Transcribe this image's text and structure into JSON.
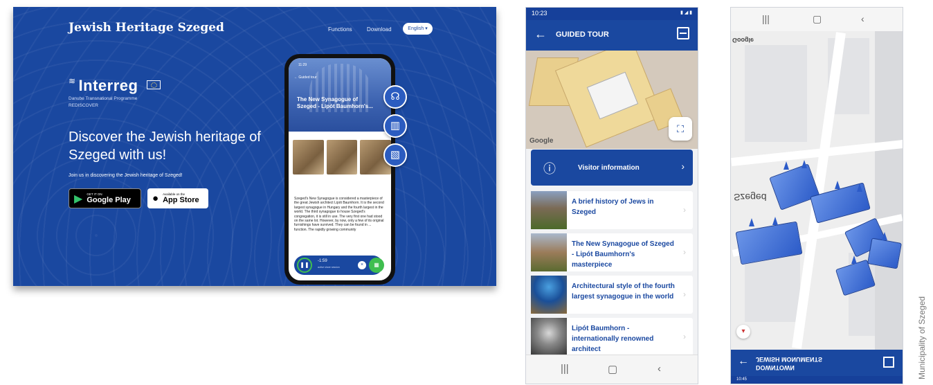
{
  "website": {
    "title": "Jewish Heritage Szeged",
    "nav": [
      "Functions",
      "Download"
    ],
    "language": "English",
    "interreg": {
      "name": "Interreg",
      "sub1": "Danube Transnational Programme",
      "sub2": "REDISCOVER"
    },
    "headline": "Discover the Jewish heritage of Szeged with us!",
    "join_text": "Join us in discovering the Jewish heritage of Szeged!",
    "google_play": {
      "small": "GET IT ON",
      "big": "Google Play"
    },
    "app_store": {
      "small": "Available on the",
      "big": "App Store"
    },
    "phone": {
      "time": "11:29",
      "back_label": "Guided tour",
      "title": "The New Synagogue of Szeged - Lipót Baumhorn's...",
      "body": "Szeged's New Synagogue is considered a masterpiece of the great Jewish architect Lipót Baumhorn. It is the second largest synagogue in Hungary and the fourth largest in the world. The third synagogue to house Szeged's congregation, it is still in use. The very first one had stood on the same lot. However, by now, only a few of its original furnishings have survived. They can be found in ... function. The rapidly growing community",
      "player_time": "-1:59",
      "player_sub": "active share session"
    }
  },
  "app1": {
    "time": "10:23",
    "title": "GUIDED TOUR",
    "map_logo": "Google",
    "visitor_info": "Visitor information",
    "items": [
      {
        "label": "A brief history of Jews in Szeged"
      },
      {
        "label": "The New Synagogue of Szeged - Lipót Baumhorn's masterpiece"
      },
      {
        "label": "Architectural style of the fourth largest synagogue in the world"
      },
      {
        "label": "Lipót Baumhorn - internationally renowned architect"
      }
    ]
  },
  "app2": {
    "map_logo": "Google",
    "city_label": "Szeged",
    "title_line1": "DOWNTOWN",
    "title_line2": "JEWISH MONUMENTS",
    "time": "10:45"
  },
  "credit": "Municipality of Szeged",
  "colors": {
    "brand_blue": "#1a48a0",
    "green": "#3fbe4f"
  }
}
